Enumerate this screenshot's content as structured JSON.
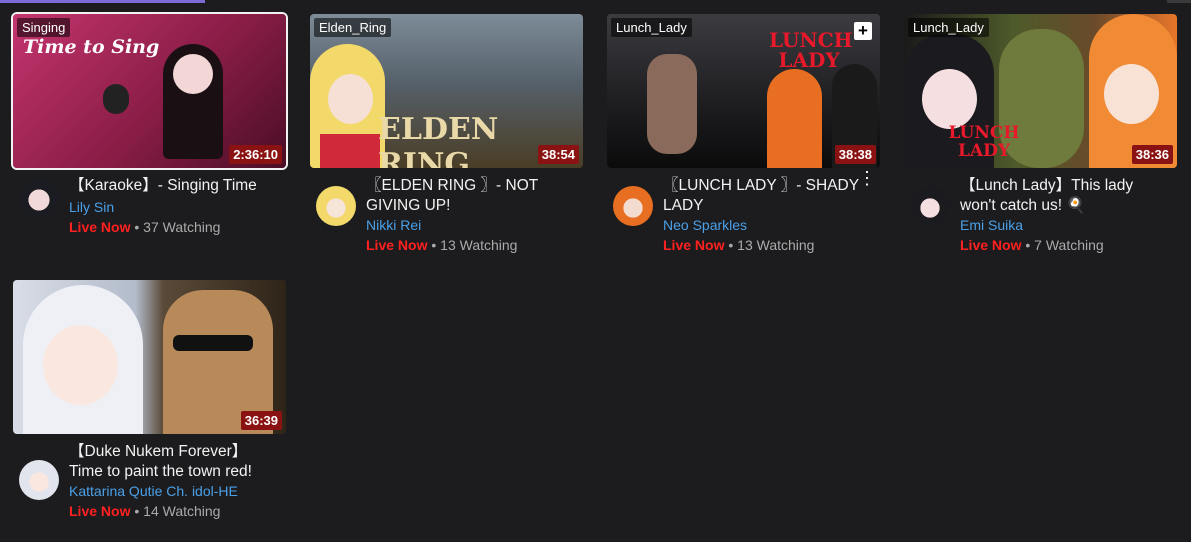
{
  "videos": [
    {
      "tag": "Singing",
      "overlay_text": "Time to Sing",
      "duration": "2:36:10",
      "title": "【Karaoke】- Singing Time",
      "channel": "Lily Sin",
      "live": "Live Now",
      "viewers": "37 Watching",
      "colors": {
        "bg1": "#b12d63",
        "bg2": "#5a0f2e"
      }
    },
    {
      "tag": "Elden_Ring",
      "overlay_text": "ELDEN RING",
      "duration": "38:54",
      "title": "〖ELDEN RING 〗- NOT GIVING UP!",
      "channel": "Nikki Rei",
      "live": "Live Now",
      "viewers": "13 Watching",
      "colors": {
        "bg1": "#5b6a78",
        "bg2": "#3b3320"
      }
    },
    {
      "tag": "Lunch_Lady",
      "overlay_text": "LUNCH LADY",
      "duration": "38:38",
      "title": "〖LUNCH LADY 〗- SHADY LADY",
      "channel": "Neo Sparkles",
      "live": "Live Now",
      "viewers": "13 Watching",
      "colors": {
        "bg1": "#2a2a2e",
        "bg2": "#0e0e10"
      }
    },
    {
      "tag": "Lunch_Lady",
      "overlay_text": "LUNCH LADY",
      "duration": "38:36",
      "title": "【Lunch Lady】This lady won't catch us! 🍳",
      "channel": "Emi Suika",
      "live": "Live Now",
      "viewers": "7 Watching",
      "colors": {
        "bg1": "#6f7a3a",
        "bg2": "#3a2a1a"
      }
    },
    {
      "tag": "",
      "overlay_text": "",
      "duration": "36:39",
      "title": "【Duke Nukem Forever】 Time to paint the town red!",
      "channel": "Kattarina Qutie Ch. idol-HE",
      "live": "Live Now",
      "viewers": "14 Watching",
      "colors": {
        "bg1": "#9aa6b8",
        "bg2": "#4a3a2a"
      }
    }
  ],
  "icons": {
    "add": "+",
    "more": "⋮"
  }
}
